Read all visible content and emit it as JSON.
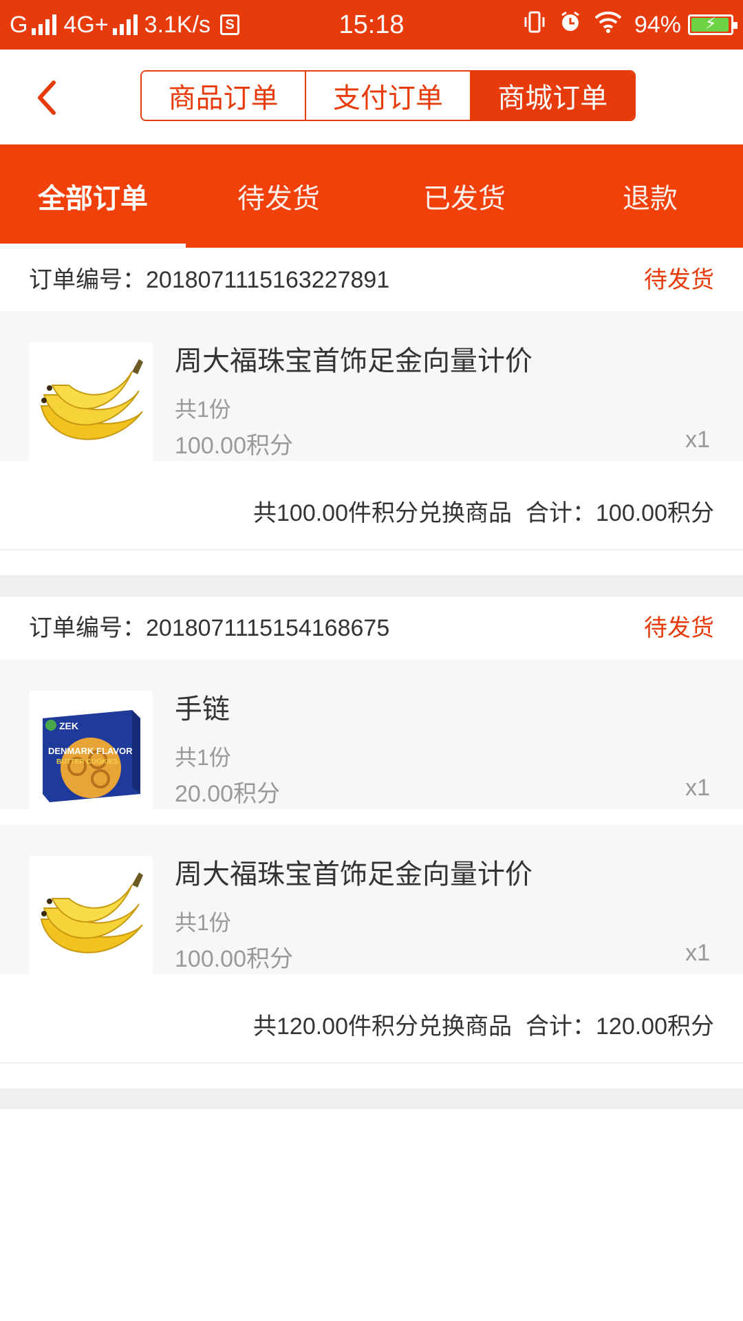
{
  "status_bar": {
    "carrier": "G",
    "network": "4G+",
    "speed": "3.1K/s",
    "s_icon": "S",
    "time": "15:18",
    "battery": "94%",
    "icons": [
      "signal-icon",
      "vibrate-icon",
      "alarm-icon",
      "wifi-icon",
      "battery-icon"
    ]
  },
  "header": {
    "back_icon": "chevron-left-icon",
    "segments": [
      {
        "label": "商品订单"
      },
      {
        "label": "支付订单"
      },
      {
        "label": "商城订单"
      }
    ]
  },
  "tabs": [
    {
      "label": "全部订单"
    },
    {
      "label": "待发货"
    },
    {
      "label": "已发货"
    },
    {
      "label": "退款"
    }
  ],
  "orders": [
    {
      "order_no": "订单编号：2018071115163227891",
      "status": "待发货",
      "items": [
        {
          "name": "周大福珠宝首饰足金向量计价",
          "qty": "共1份",
          "price": "100.00积分",
          "mult": "x1",
          "image": "banana-image"
        }
      ],
      "summary_count": "共100.00件积分兑换商品",
      "summary_total": "合计：100.00积分"
    },
    {
      "order_no": "订单编号：2018071115154168675",
      "status": "待发货",
      "items": [
        {
          "name": "手链",
          "qty": "共1份",
          "price": "20.00积分",
          "mult": "x1",
          "image": "cookie-box-image",
          "box_brand": "ZEK",
          "box_title": "DENMARK FLAVOR",
          "box_sub": "BUTTER COOKIES"
        },
        {
          "name": "周大福珠宝首饰足金向量计价",
          "qty": "共1份",
          "price": "100.00积分",
          "mult": "x1",
          "image": "banana-image"
        }
      ],
      "summary_count": "共120.00件积分兑换商品",
      "summary_total": "合计：120.00积分"
    }
  ],
  "colors": {
    "accent": "#e83b0b",
    "tab_bg": "#f2400a",
    "muted": "#999999",
    "item_bg": "#f7f7f7"
  }
}
